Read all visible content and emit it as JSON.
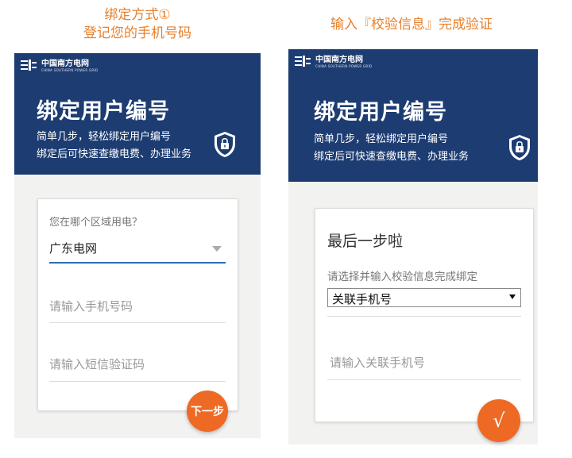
{
  "captions": {
    "left_line1": "绑定方式①",
    "left_line2": "登记您的手机号码",
    "right": "输入『校验信息』完成验证"
  },
  "brand": {
    "name": "中国南方电网",
    "subname": "CHINA SOUTHERN POWER GRID"
  },
  "banner": {
    "title": "绑定用户编号",
    "desc_line1": "简单几步，轻松绑定用户编号",
    "desc_line2": "绑定后可快速查缴电费、办理业务"
  },
  "step1": {
    "region_hint": "您在哪个区域用电？",
    "region_value": "广东电网",
    "phone_placeholder": "请输入手机号码",
    "sms_placeholder": "请输入短信验证码",
    "next_label": "下一步"
  },
  "step2": {
    "title": "最后一步啦",
    "hint": "请选择并输入校验信息完成绑定",
    "select_value": "关联手机号",
    "phone_placeholder": "请输入关联手机号",
    "confirm_label": "√"
  },
  "colors": {
    "caption": "#e8802c",
    "banner": "#1d3c72",
    "accent": "#ee6a24",
    "underline_active": "#2b6fb7"
  },
  "icons": {
    "logo": "grid-logo-icon",
    "shield": "shield-lock-icon",
    "dropdown": "caret-down-icon"
  }
}
